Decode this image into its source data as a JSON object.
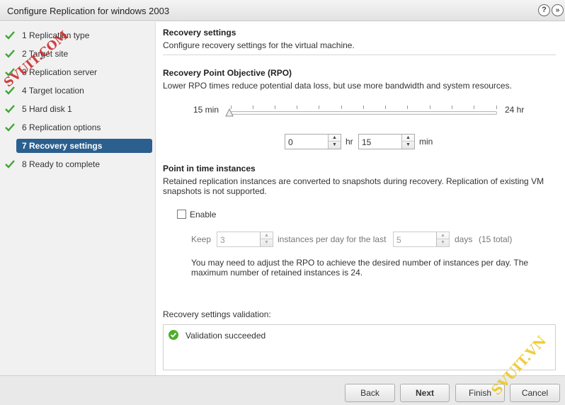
{
  "window": {
    "title": "Configure Replication for windows 2003",
    "help_label": "?",
    "close_label": "»",
    "help_icon": "help-icon",
    "popout_icon": "popout-icon"
  },
  "sidebar": {
    "steps": [
      {
        "num": "1",
        "label": "Replication type",
        "done": true
      },
      {
        "num": "2",
        "label": "Target site",
        "done": true
      },
      {
        "num": "3",
        "label": "Replication server",
        "done": true
      },
      {
        "num": "4",
        "label": "Target location",
        "done": true
      },
      {
        "num": "5",
        "label": "Hard disk 1",
        "done": true
      },
      {
        "num": "6",
        "label": "Replication options",
        "done": true
      },
      {
        "num": "7",
        "label": "Recovery settings",
        "active": true
      },
      {
        "num": "8",
        "label": "Ready to complete",
        "done": true
      }
    ],
    "step_labels": [
      "1  Replication type",
      "2  Target site",
      "3  Replication server",
      "4  Target location",
      "5  Hard disk 1",
      "6  Replication options",
      "7  Recovery settings",
      "8  Ready to complete"
    ]
  },
  "main": {
    "header_title": "Recovery settings",
    "header_desc": "Configure recovery settings for the virtual machine.",
    "rpo": {
      "title": "Recovery Point Objective (RPO)",
      "desc": "Lower RPO times reduce potential data loss, but use more bandwidth and system resources.",
      "slider_min_label": "15 min",
      "slider_max_label": "24 hr",
      "slider_value_fraction": 0,
      "hours_value": "0",
      "hours_unit": "hr",
      "minutes_value": "15",
      "minutes_unit": "min"
    },
    "pit": {
      "title": "Point in time instances",
      "desc": "Retained replication instances are converted to snapshots during recovery. Replication of existing VM snapshots is not supported.",
      "enable_label": "Enable",
      "enable_checked": false,
      "keep_label": "Keep",
      "keep_value": "3",
      "instances_label": "instances per day for the last",
      "days_value": "5",
      "days_label": "days",
      "total_label": "(15 total)",
      "note": "You may need to adjust the RPO to achieve the desired number of instances per day. The maximum number of retained instances is 24."
    },
    "validation": {
      "title": "Recovery settings validation:",
      "message": "Validation succeeded",
      "status_color": "#4caf2a"
    }
  },
  "footer": {
    "back_label": "Back",
    "next_label": "Next",
    "finish_label": "Finish",
    "cancel_label": "Cancel"
  },
  "watermarks": {
    "top_left": "SVUIT.COM",
    "bottom_right": "SVUIT.VN"
  },
  "colors": {
    "check_green": "#3fa535",
    "active_step_bg": "#2b5f8e"
  }
}
